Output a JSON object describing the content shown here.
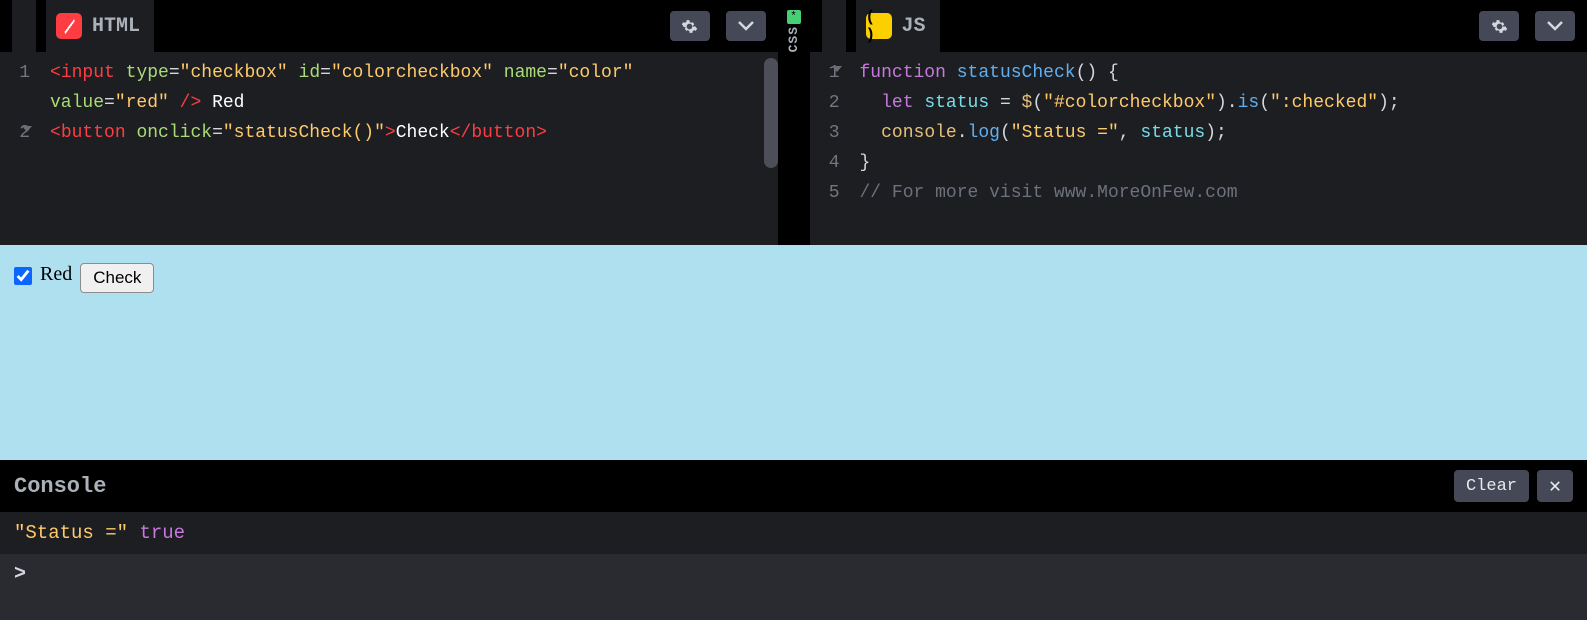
{
  "panels": {
    "html": {
      "title": "HTML"
    },
    "css": {
      "title": "CSS",
      "marker": "*"
    },
    "js": {
      "title": "JS"
    }
  },
  "html_code": {
    "lines": [
      {
        "n": "1",
        "segs": [
          {
            "t": "<",
            "c": "tag"
          },
          {
            "t": "input",
            "c": "tag"
          },
          {
            "t": " ",
            "c": ""
          },
          {
            "t": "type",
            "c": "attr"
          },
          {
            "t": "=",
            "c": ""
          },
          {
            "t": "\"checkbox\"",
            "c": "str"
          },
          {
            "t": " ",
            "c": ""
          },
          {
            "t": "id",
            "c": "attr"
          },
          {
            "t": "=",
            "c": ""
          },
          {
            "t": "\"colorcheckbox\"",
            "c": "str"
          },
          {
            "t": " ",
            "c": ""
          },
          {
            "t": "name",
            "c": "attr"
          },
          {
            "t": "=",
            "c": ""
          },
          {
            "t": "\"color\"",
            "c": "str"
          }
        ]
      },
      {
        "n": "",
        "segs": [
          {
            "t": "value",
            "c": "attr"
          },
          {
            "t": "=",
            "c": ""
          },
          {
            "t": "\"red\"",
            "c": "str"
          },
          {
            "t": " ",
            "c": ""
          },
          {
            "t": "/>",
            "c": "tag"
          },
          {
            "t": " Red",
            "c": "plain"
          }
        ]
      },
      {
        "n": "2",
        "fold": true,
        "segs": [
          {
            "t": "<",
            "c": "tag"
          },
          {
            "t": "button",
            "c": "tag"
          },
          {
            "t": " ",
            "c": ""
          },
          {
            "t": "onclick",
            "c": "attr"
          },
          {
            "t": "=",
            "c": ""
          },
          {
            "t": "\"statusCheck()\"",
            "c": "str"
          },
          {
            "t": ">",
            "c": "tag"
          },
          {
            "t": "Check",
            "c": "plain"
          },
          {
            "t": "</",
            "c": "tag"
          },
          {
            "t": "button",
            "c": "tag"
          },
          {
            "t": ">",
            "c": "tag"
          }
        ]
      }
    ]
  },
  "js_code": {
    "lines": [
      {
        "n": "1",
        "fold": true,
        "segs": [
          {
            "t": "function",
            "c": "kw2"
          },
          {
            "t": " ",
            "c": ""
          },
          {
            "t": "statusCheck",
            "c": "fn"
          },
          {
            "t": "()",
            "c": ""
          },
          {
            "t": " {",
            "c": ""
          }
        ]
      },
      {
        "n": "2",
        "segs": [
          {
            "t": "  ",
            "c": ""
          },
          {
            "t": "let",
            "c": "kw2"
          },
          {
            "t": " ",
            "c": ""
          },
          {
            "t": "status",
            "c": "ident"
          },
          {
            "t": " = ",
            "c": ""
          },
          {
            "t": "$",
            "c": "obj"
          },
          {
            "t": "(",
            "c": ""
          },
          {
            "t": "\"#colorcheckbox\"",
            "c": "str"
          },
          {
            "t": ").",
            "c": ""
          },
          {
            "t": "is",
            "c": "fn"
          },
          {
            "t": "(",
            "c": ""
          },
          {
            "t": "\":checked\"",
            "c": "str"
          },
          {
            "t": ");",
            "c": ""
          }
        ]
      },
      {
        "n": "3",
        "segs": [
          {
            "t": "  ",
            "c": ""
          },
          {
            "t": "console",
            "c": "obj"
          },
          {
            "t": ".",
            "c": ""
          },
          {
            "t": "log",
            "c": "fn"
          },
          {
            "t": "(",
            "c": ""
          },
          {
            "t": "\"Status =\"",
            "c": "str"
          },
          {
            "t": ", ",
            "c": ""
          },
          {
            "t": "status",
            "c": "ident"
          },
          {
            "t": ");",
            "c": ""
          }
        ]
      },
      {
        "n": "4",
        "segs": [
          {
            "t": "}",
            "c": ""
          }
        ]
      },
      {
        "n": "5",
        "segs": [
          {
            "t": "// For more visit www.MoreOnFew.com",
            "c": "comment"
          }
        ]
      }
    ]
  },
  "preview": {
    "checkbox_label": "Red",
    "button_label": "Check",
    "checked": true
  },
  "console": {
    "title": "Console",
    "clear_label": "Clear",
    "close_label": "✕",
    "output_string": "\"Status =\"",
    "output_value": "true",
    "prompt": ">"
  }
}
